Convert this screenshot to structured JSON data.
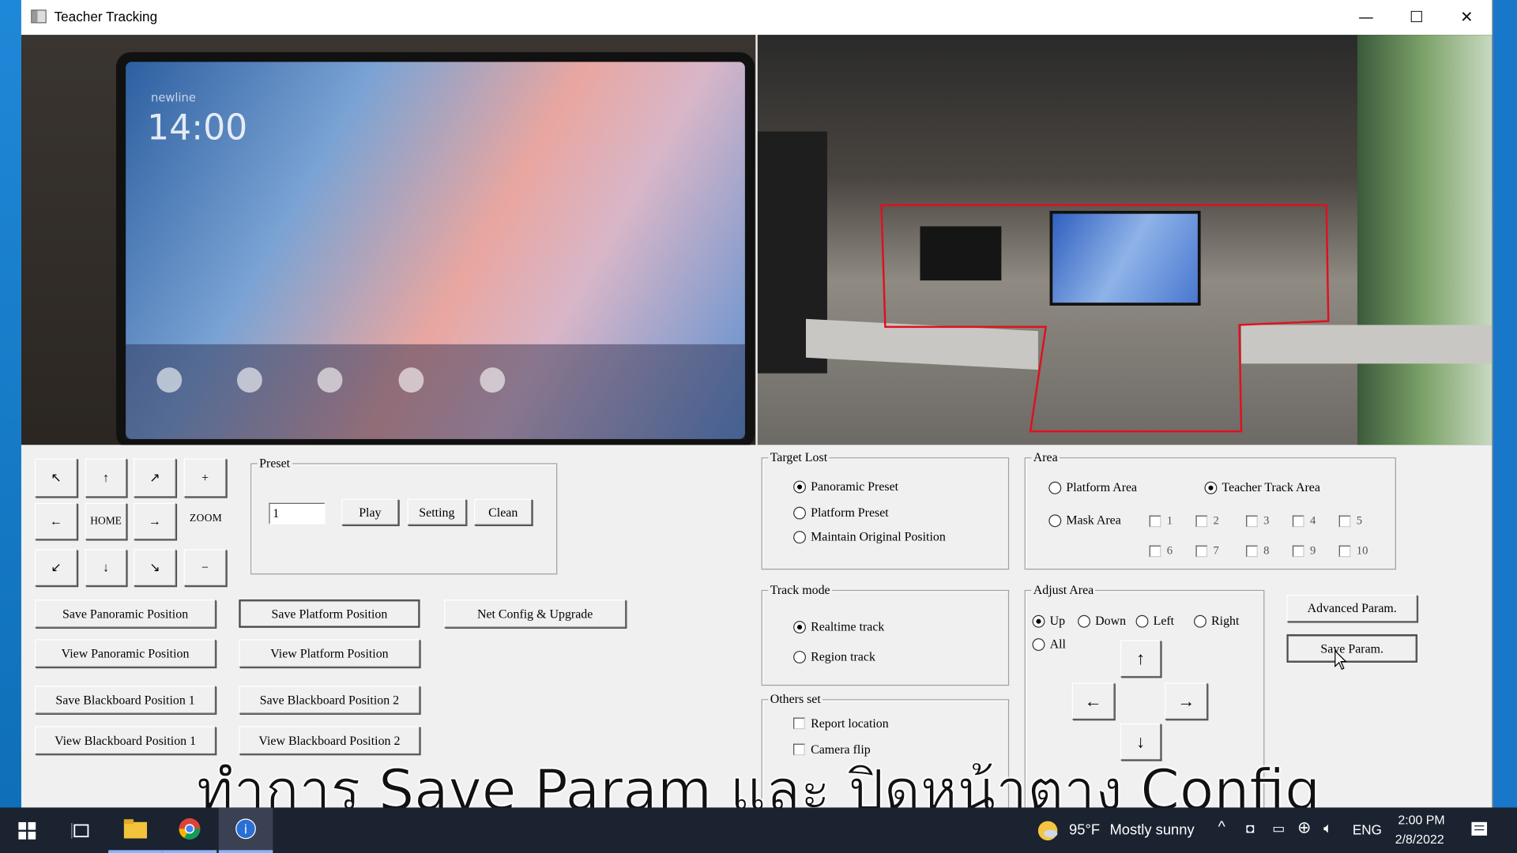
{
  "window": {
    "title": "Teacher Tracking",
    "minimize": "—",
    "maximize": "☐",
    "close": "✕"
  },
  "camera_left": {
    "brand": "newline",
    "clock": "14:00"
  },
  "ptz": {
    "up_left": "↖",
    "up": "↑",
    "up_right": "↗",
    "zoom_in": "+",
    "left": "←",
    "home": "HOME",
    "right": "→",
    "zoom_label": "ZOOM",
    "down_left": "↙",
    "down": "↓",
    "down_right": "↘",
    "zoom_out": "−"
  },
  "preset": {
    "legend": "Preset",
    "value": "1",
    "play": "Play",
    "setting": "Setting",
    "clean": "Clean"
  },
  "positions": {
    "save_panoramic": "Save Panoramic Position",
    "save_platform": "Save Platform Position",
    "net_config": "Net Config & Upgrade",
    "view_panoramic": "View Panoramic Position",
    "view_platform": "View Platform Position",
    "save_blackboard_1": "Save Blackboard Position 1",
    "save_blackboard_2": "Save Blackboard Position 2",
    "view_blackboard_1": "View Blackboard Position 1",
    "view_blackboard_2": "View Blackboard Position 2"
  },
  "target_lost": {
    "legend": "Target Lost",
    "options": [
      "Panoramic Preset",
      "Platform Preset",
      "Maintain Original Position"
    ],
    "selected": "Panoramic Preset"
  },
  "area": {
    "legend": "Area",
    "platform": "Platform Area",
    "teacher_track": "Teacher Track Area",
    "mask": "Mask Area",
    "selected": "Teacher Track Area",
    "mask_slots": [
      "1",
      "2",
      "3",
      "4",
      "5",
      "6",
      "7",
      "8",
      "9",
      "10"
    ]
  },
  "track_mode": {
    "legend": "Track mode",
    "options": [
      "Realtime track",
      "Region track"
    ],
    "selected": "Realtime track"
  },
  "others": {
    "legend": "Others set",
    "report_location": "Report location",
    "camera_flip": "Camera flip"
  },
  "adjust_area": {
    "legend": "Adjust Area",
    "options": [
      "Up",
      "Down",
      "Left",
      "Right",
      "All"
    ],
    "selected": "Up",
    "up": "↑",
    "left": "←",
    "right": "→",
    "down": "↓"
  },
  "params": {
    "advanced": "Advanced Param.",
    "save": "Save Param."
  },
  "subtitle": "ทำการ Save Param และ ปิดหน้าตาง Config",
  "taskbar": {
    "weather_temp": "95°F",
    "weather_text": "Mostly sunny",
    "language": "ENG",
    "time": "2:00 PM",
    "date": "2/8/2022"
  },
  "colors": {
    "track_area": "#e0101e",
    "taskbar": "#1b2230",
    "panel": "#f0f0f0"
  }
}
